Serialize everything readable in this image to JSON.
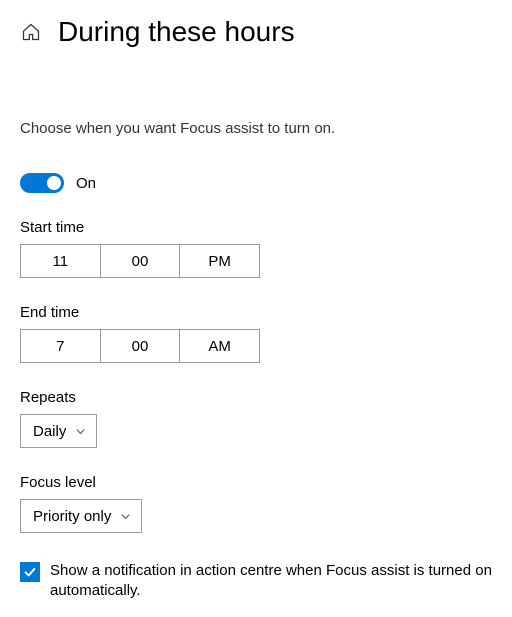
{
  "header": {
    "title": "During these hours"
  },
  "description": "Choose when you want Focus assist to turn on.",
  "toggle": {
    "state_label": "On",
    "enabled": true
  },
  "start_time": {
    "label": "Start time",
    "hour": "11",
    "minute": "00",
    "meridiem": "PM"
  },
  "end_time": {
    "label": "End time",
    "hour": "7",
    "minute": "00",
    "meridiem": "AM"
  },
  "repeats": {
    "label": "Repeats",
    "value": "Daily"
  },
  "focus_level": {
    "label": "Focus level",
    "value": "Priority only"
  },
  "notification_checkbox": {
    "label": "Show a notification in action centre when Focus assist is turned on automatically.",
    "checked": true
  }
}
